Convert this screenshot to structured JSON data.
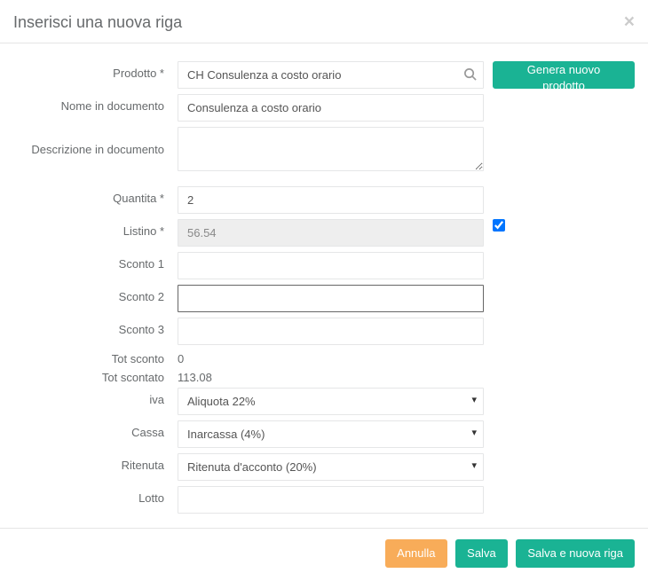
{
  "header": {
    "title": "Inserisci una nuova riga"
  },
  "labels": {
    "prodotto": "Prodotto *",
    "nome_documento": "Nome in documento",
    "descrizione_documento": "Descrizione in documento",
    "quantita": "Quantita *",
    "listino": "Listino *",
    "sconto1": "Sconto 1",
    "sconto2": "Sconto 2",
    "sconto3": "Sconto 3",
    "tot_sconto": "Tot sconto",
    "tot_scontato": "Tot scontato",
    "iva": "iva",
    "cassa": "Cassa",
    "ritenuta": "Ritenuta",
    "lotto": "Lotto"
  },
  "values": {
    "prodotto": "CH Consulenza a costo orario",
    "nome_documento": "Consulenza a costo orario",
    "descrizione_documento": "",
    "quantita": "2",
    "listino": "56.54",
    "listino_checked": true,
    "sconto1": "",
    "sconto2": "",
    "sconto3": "",
    "tot_sconto": "0",
    "tot_scontato": "113.08",
    "iva_selected": "Aliquota 22%",
    "cassa_selected": "Inarcassa (4%)",
    "ritenuta_selected": "Ritenuta d'acconto (20%)",
    "lotto": ""
  },
  "buttons": {
    "genera": "Genera nuovo prodotto",
    "annulla": "Annulla",
    "salva": "Salva",
    "salva_nuova": "Salva e nuova riga"
  },
  "icons": {
    "close": "×",
    "search": "search"
  }
}
